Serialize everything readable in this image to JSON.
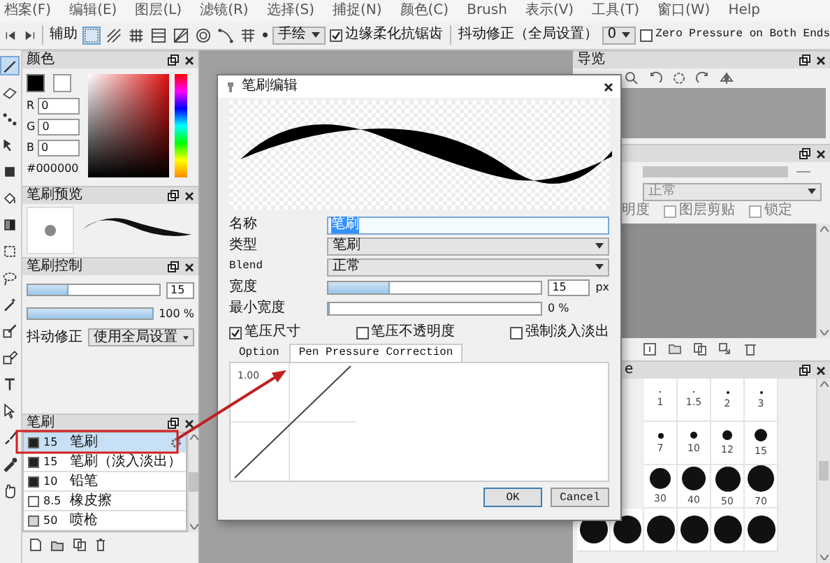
{
  "menu": [
    "档案(F)",
    "编辑(E)",
    "图层(L)",
    "滤镜(R)",
    "选择(S)",
    "捕捉(N)",
    "颜色(C)",
    "Brush",
    "表示(V)",
    "工具(T)",
    "窗口(W)",
    "Help"
  ],
  "toolbar": {
    "assist_label": "辅助",
    "snap_modes": [
      {
        "selected": true
      },
      {
        "selected": false
      },
      {
        "selected": false
      },
      {
        "selected": false
      },
      {
        "selected": false
      },
      {
        "selected": false
      },
      {
        "selected": false
      },
      {
        "selected": false
      }
    ],
    "stroke_mode": "手绘",
    "antialias": {
      "label": "边缘柔化抗锯齿",
      "checked": true
    },
    "stabilizer_label": "抖动修正（全局设置）",
    "stabilizer_value": "0",
    "zero_pressure": {
      "label": "Zero Pressure on Both Ends",
      "checked": false
    }
  },
  "tools": [
    {
      "selected": true
    },
    {
      "selected": false
    },
    {
      "selected": false
    },
    {
      "selected": false
    },
    {
      "selected": false
    },
    {
      "selected": false
    },
    {
      "selected": false
    },
    {
      "selected": false
    },
    {
      "selected": false
    },
    {
      "selected": false
    },
    {
      "selected": false
    },
    {
      "selected": false
    },
    {
      "selected": false
    },
    {
      "selected": false
    },
    {
      "selected": false
    },
    {
      "selected": false
    },
    {
      "selected": false
    }
  ],
  "color_panel": {
    "title": "颜色",
    "channels": [
      {
        "label": "R",
        "value": "0"
      },
      {
        "label": "G",
        "value": "0"
      },
      {
        "label": "B",
        "value": "0"
      }
    ],
    "hex": "#000000"
  },
  "brush_preview": {
    "title": "笔刷预览"
  },
  "brush_control": {
    "title": "笔刷控制",
    "size": {
      "level": 0.3,
      "value": "15"
    },
    "opacity": {
      "level": 1,
      "value": "100 %"
    },
    "stabilizer": {
      "label": "抖动修正",
      "value": "使用全局设置"
    }
  },
  "brush_list": {
    "title": "笔刷",
    "items": [
      {
        "size": "15",
        "name": "笔刷",
        "color": "#222222",
        "selected": true
      },
      {
        "size": "15",
        "name": "笔刷（淡入淡出）",
        "color": "#222222",
        "selected": false
      },
      {
        "size": "10",
        "name": "铅笔",
        "color": "#222222",
        "selected": false
      },
      {
        "size": "8.5",
        "name": "橡皮擦",
        "color": "#ffffff",
        "selected": false
      },
      {
        "size": "50",
        "name": "喷枪",
        "color": "#d4d4d4",
        "selected": false
      }
    ]
  },
  "navigator": {
    "title": "导览"
  },
  "layers": {
    "blend": "正常",
    "opacity_label": "明度",
    "options": [
      {
        "label": "图层剪贴",
        "checked": false
      },
      {
        "label": "锁定",
        "checked": false
      }
    ]
  },
  "brush_size": {
    "title": "e",
    "rows": [
      {
        "labels": [
          "1",
          "1.5",
          "2",
          "3"
        ]
      },
      {
        "labels": [
          "7",
          "10",
          "12",
          "15"
        ]
      },
      {
        "labels": [
          "30",
          "40",
          "50",
          "70"
        ]
      }
    ]
  },
  "dialog": {
    "title": "笔刷编辑",
    "name_label": "名称",
    "name_value": "笔刷",
    "type_label": "类型",
    "type_value": "笔刷",
    "blend_label": "Blend",
    "blend_value": "正常",
    "width": {
      "label": "宽度",
      "level": 0.28,
      "value": "15",
      "unit": "px"
    },
    "min_width": {
      "label": "最小宽度",
      "level": 0,
      "value": "0 %"
    },
    "checks": [
      {
        "label": "笔压尺寸",
        "checked": true
      },
      {
        "label": "笔压不透明度",
        "checked": false
      },
      {
        "label": "强制淡入淡出",
        "checked": false
      }
    ],
    "tabs": [
      {
        "label": "Option",
        "selected": false
      },
      {
        "label": "Pen Pressure Correction",
        "selected": true
      }
    ],
    "curve_label": "1.00",
    "buttons": [
      "OK",
      "Cancel"
    ]
  }
}
